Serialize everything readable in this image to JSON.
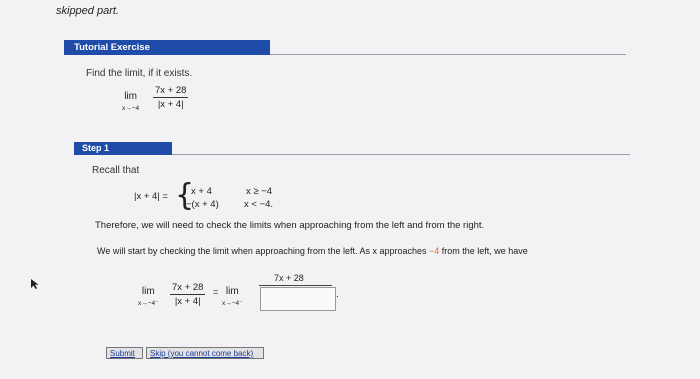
{
  "header": {
    "title": "skipped part."
  },
  "tutorial": {
    "section_label": "Tutorial Exercise",
    "prompt": "Find the limit, if it exists.",
    "limit": {
      "lim": "lim",
      "approach": "x→−4",
      "numerator": "7x + 28",
      "denominator": "|x + 4|"
    }
  },
  "step1": {
    "label": "Step 1",
    "recall": "Recall that",
    "abs_lhs": "|x + 4| =",
    "cases": [
      {
        "expr": "x + 4",
        "cond": "x ≥ −4"
      },
      {
        "expr": "−(x + 4)",
        "cond": "x < −4."
      }
    ],
    "therefore": "Therefore, we will need to check the limits when approaching from the left and from the right.",
    "start_pre": "We will start by checking the limit when approaching from the left. As x approaches ",
    "start_value": "−4",
    "start_post": " from the left, we have",
    "left_limit": {
      "lim": "lim",
      "approach": "x→−4⁻",
      "numerator": "7x + 28",
      "denominator": "|x + 4|",
      "equals": "=",
      "lim_rhs": "lim",
      "approach_rhs": "x→−4⁻",
      "rhs_numerator": "7x + 28",
      "answer_value": "",
      "trailing": "."
    }
  },
  "buttons": {
    "submit": "Submit",
    "skip": "Skip (you cannot come back)"
  },
  "colors": {
    "accent": "#1f4ca8",
    "highlight": "#e06a2a"
  }
}
